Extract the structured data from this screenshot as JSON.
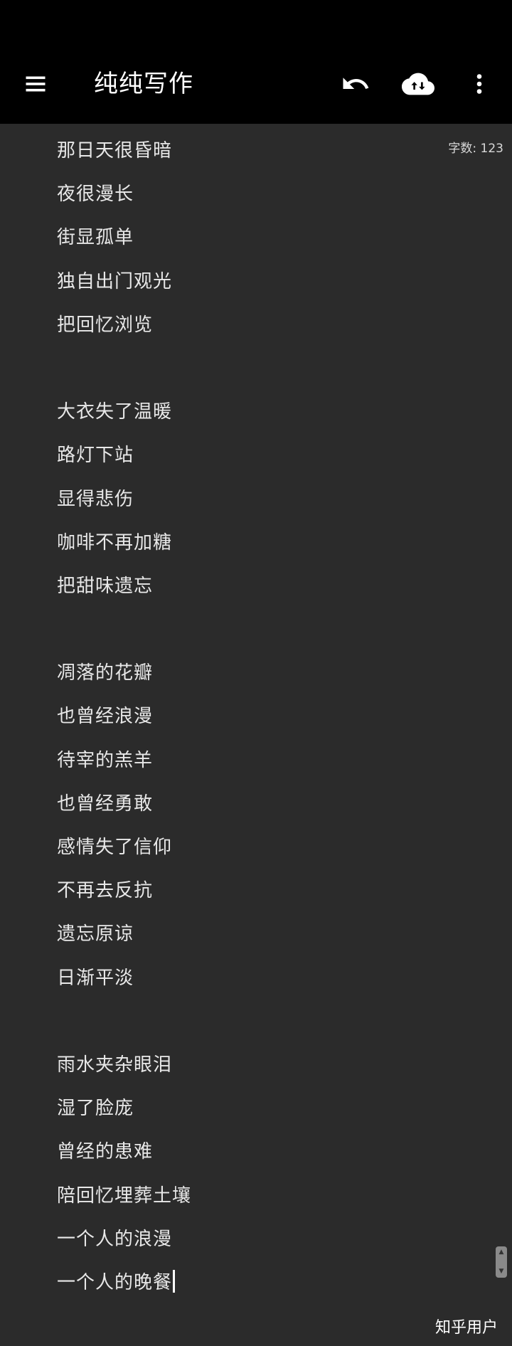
{
  "app_bar": {
    "title": "纯纯写作",
    "menu_icon": "hamburger-menu-icon",
    "undo_icon": "undo-icon",
    "cloud_icon": "cloud-sync-icon",
    "more_icon": "more-vert-icon"
  },
  "editor": {
    "word_count": "字数: 123",
    "lines": [
      "那日天很昏暗",
      "夜很漫长",
      "街显孤单",
      "独自出门观光",
      "把回忆浏览",
      "",
      "大衣失了温暖",
      "路灯下站",
      "显得悲伤",
      "咖啡不再加糖",
      "把甜味遗忘",
      "",
      "凋落的花瓣",
      "也曾经浪漫",
      "待宰的羔羊",
      "也曾经勇敢",
      "感情失了信仰",
      "不再去反抗",
      "遗忘原谅",
      "日渐平淡",
      "",
      "雨水夹杂眼泪",
      "湿了脸庞",
      "曾经的患难",
      "陪回忆埋葬土壤",
      "一个人的浪漫",
      "一个人的晚餐"
    ]
  },
  "watermark": "知乎用户"
}
